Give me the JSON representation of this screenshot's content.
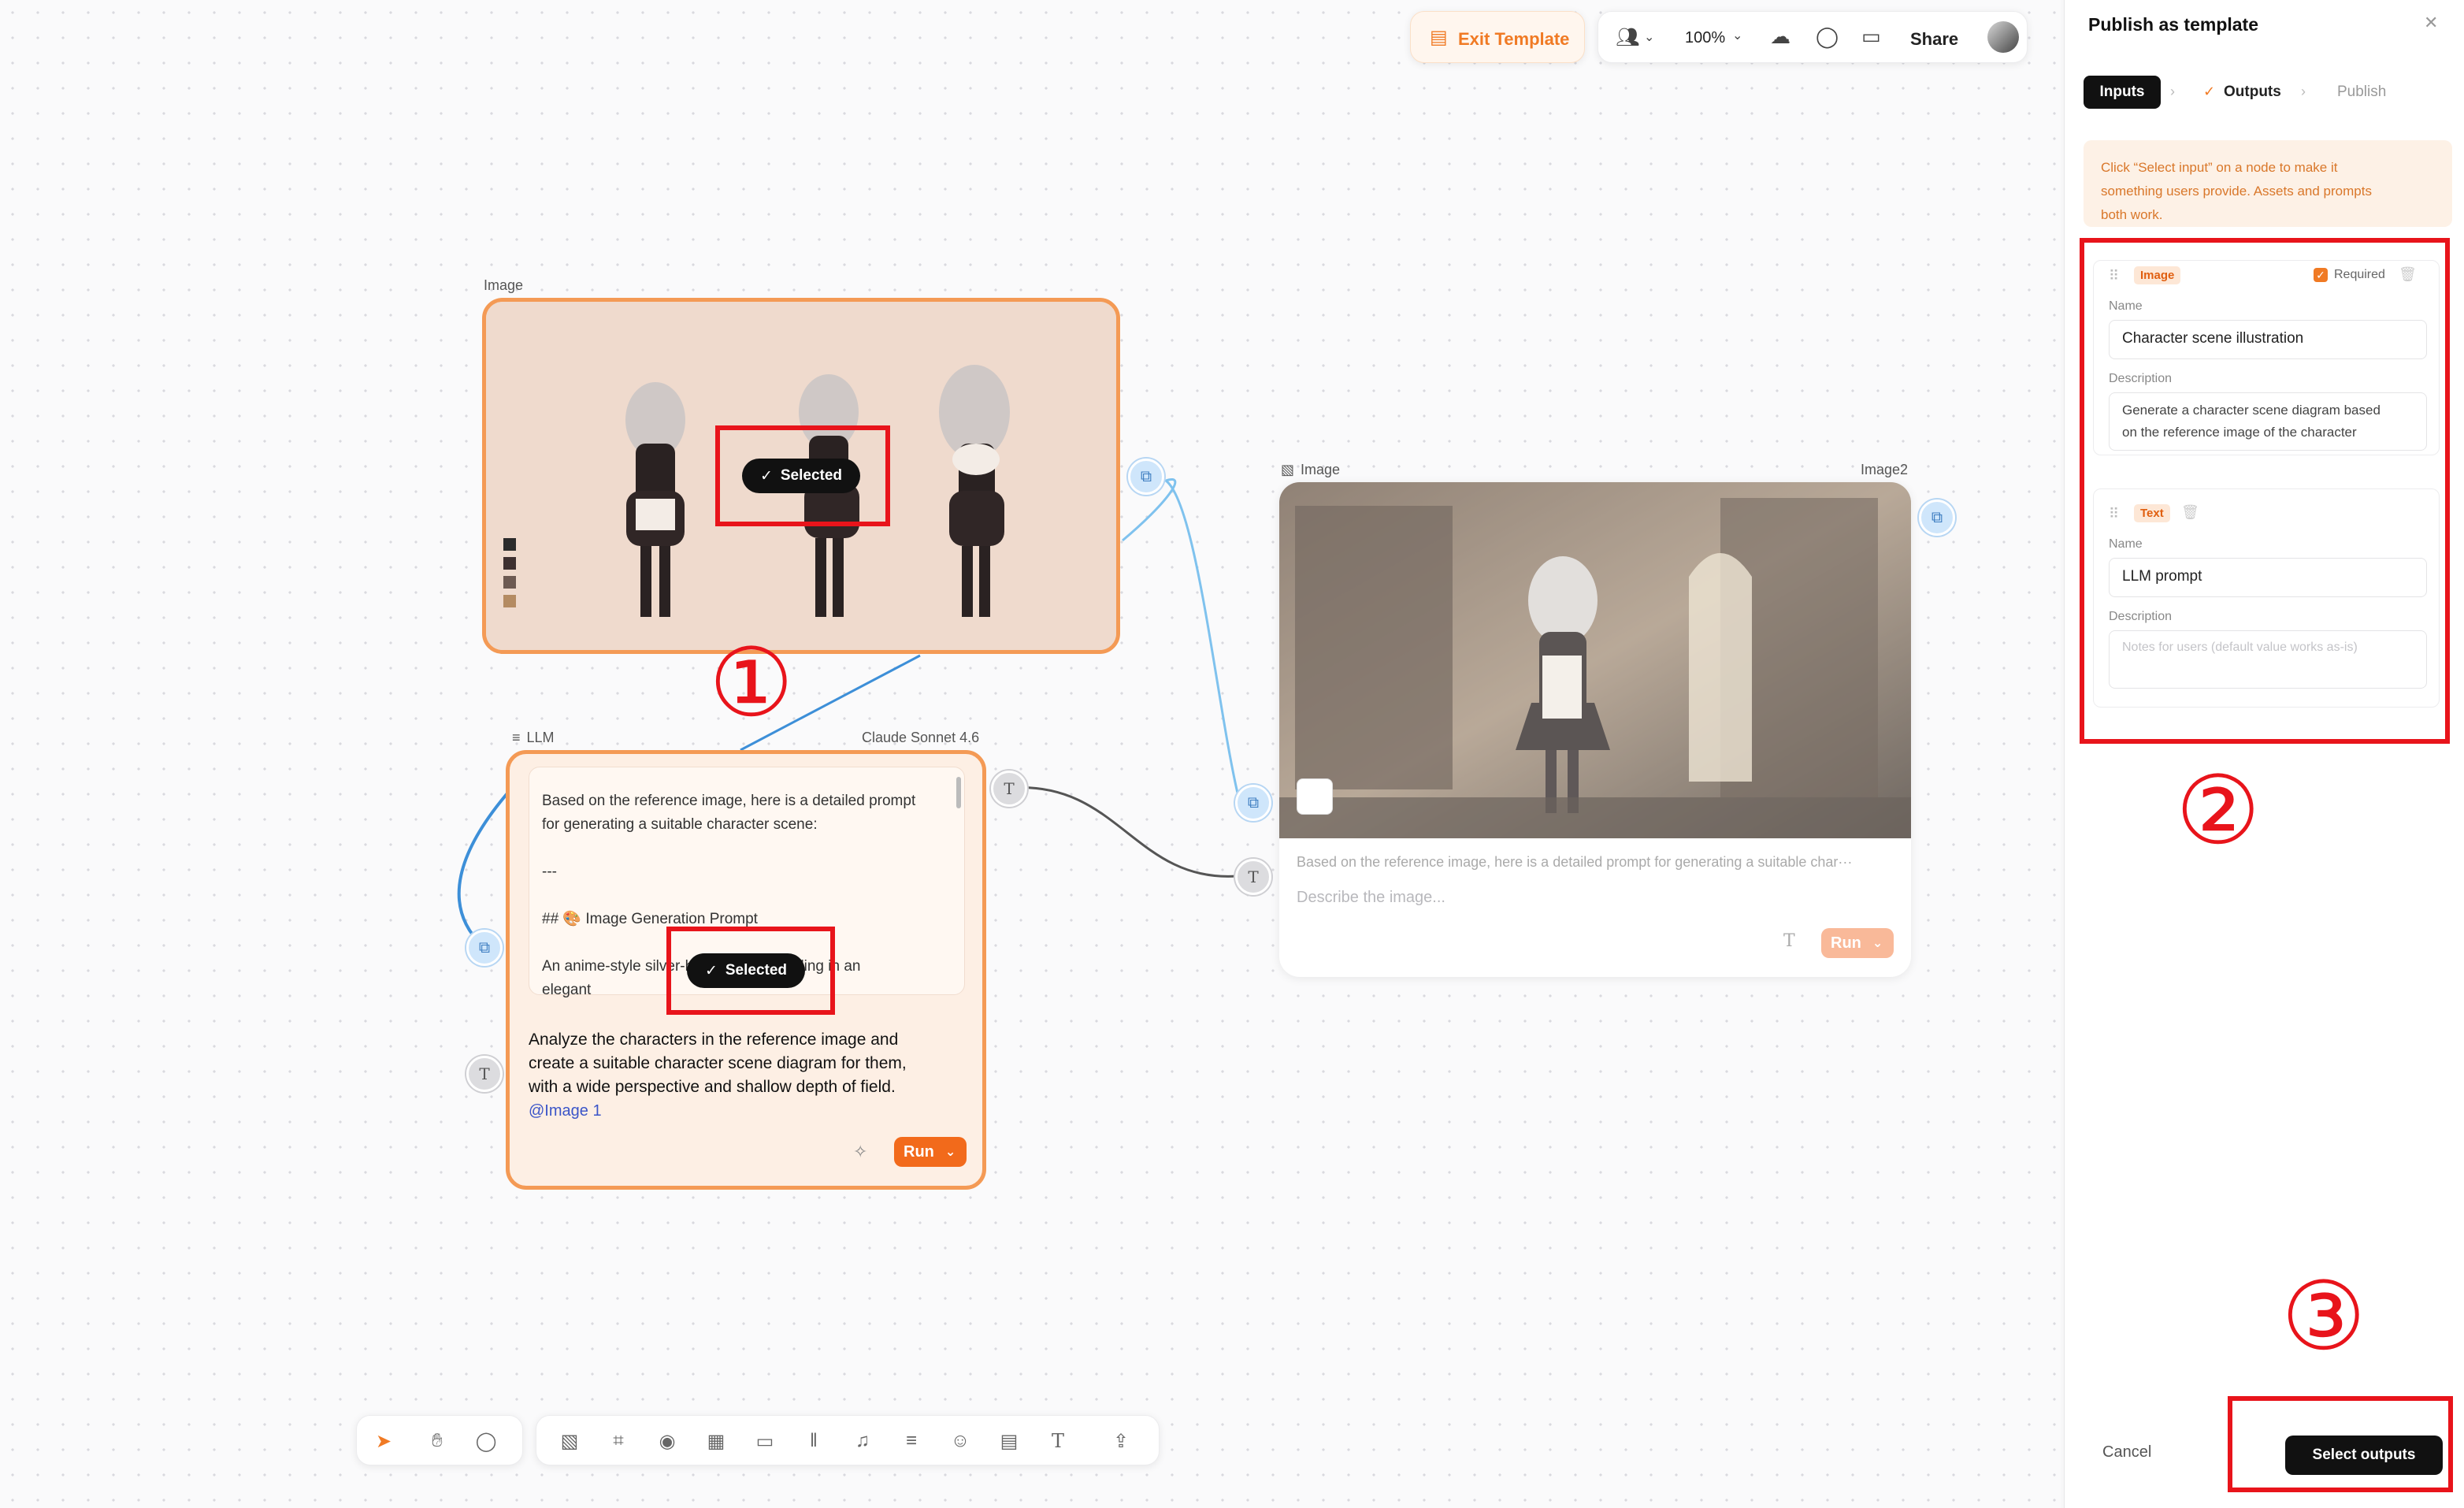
{
  "toolbar": {
    "exit_template": "Exit Template",
    "zoom": "100%",
    "share": "Share"
  },
  "nodes": {
    "image1": {
      "label": "Image",
      "selected_label": "Selected"
    },
    "llm": {
      "label": "LLM",
      "model": "Claude Sonnet 4.6",
      "output_lines": [
        "Based on the reference image, here is a detailed prompt",
        "for generating a suitable character scene:",
        "---",
        "## 🎨 Image Generation Prompt",
        "An anime-style silver-haired maid standing in an",
        "elegant"
      ],
      "selected_label": "Selected",
      "prompt_lines": [
        "Analyze the characters in the reference image and",
        "create a suitable character scene diagram for them,",
        "with a wide perspective and shallow depth of field."
      ],
      "mention": "@Image 1",
      "run": "Run"
    },
    "image2": {
      "label": "Image",
      "name": "Image2",
      "prompt_preview": "Based on the reference image, here is a detailed prompt for generating a suitable char···",
      "placeholder": "Describe the image...",
      "run": "Run"
    }
  },
  "annotations": {
    "one": "①",
    "two": "②",
    "three": "③"
  },
  "panel": {
    "title": "Publish as template",
    "steps": [
      "Inputs",
      "Outputs",
      "Publish"
    ],
    "hint": "Click “Select input” on a node to make it something users provide. Assets and prompts both work.",
    "hint_lines": [
      "Click “Select input” on a node to make it",
      "something users provide. Assets and prompts",
      "both work."
    ],
    "inputs": [
      {
        "type": "Image",
        "required_label": "Required",
        "required": true,
        "name_label": "Name",
        "name": "Character scene illustration",
        "description_label": "Description",
        "description_lines": [
          "Generate a character scene diagram based",
          "on the reference image of the character"
        ]
      },
      {
        "type": "Text",
        "name_label": "Name",
        "name": "LLM prompt",
        "description_label": "Description",
        "description_placeholder": "Notes for users (default value works as-is)"
      }
    ],
    "cancel": "Cancel",
    "next": "Select outputs"
  },
  "colors": {
    "accent": "#f07a24",
    "annotation_red": "#e8141b",
    "connector_blue": "#6ab5e8"
  }
}
